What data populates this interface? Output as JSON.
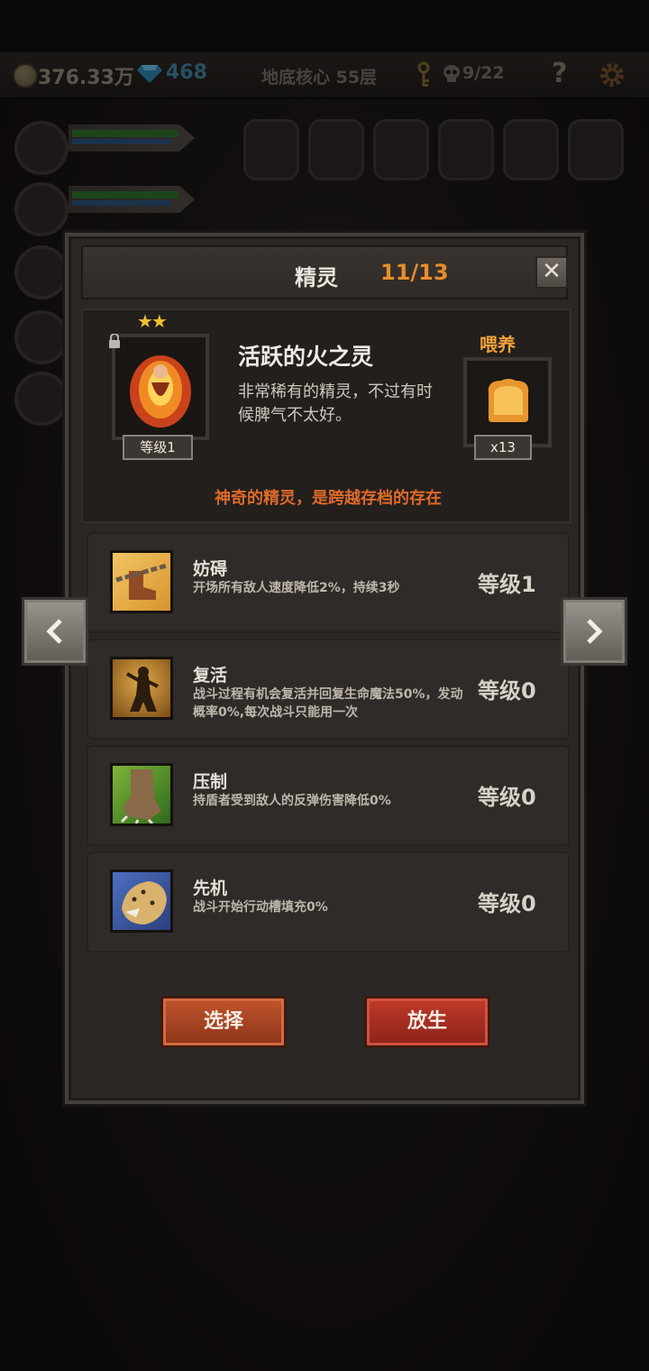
{
  "topbar": {
    "gold": "376.33万",
    "gems": "468",
    "floor": "地底核心 55层",
    "skulls": "9/22",
    "help": "?"
  },
  "modal": {
    "title": "精灵",
    "count": "11/13",
    "close": "✕",
    "spirit": {
      "name": "活跃的火之灵",
      "description": "非常稀有的精灵，不过有时候脾气不太好。",
      "stars": "★★",
      "level": "等级1",
      "flavor": "神奇的精灵，是跨越存档的存在"
    },
    "feed": {
      "label": "喂养",
      "count": "x13"
    },
    "skills": [
      {
        "name": "妨碍",
        "desc": "开场所有敌人速度降低2%，持续3秒",
        "level": "等级1"
      },
      {
        "name": "复活",
        "desc": "战斗过程有机会复活并回复生命魔法50%，发动概率0%,每次战斗只能用一次",
        "level": "等级0"
      },
      {
        "name": "压制",
        "desc": "持盾者受到敌人的反弹伤害降低0%",
        "level": "等级0"
      },
      {
        "name": "先机",
        "desc": "战斗开始行动槽填充0%",
        "level": "等级0"
      }
    ],
    "buttons": {
      "select": "选择",
      "release": "放生"
    }
  }
}
